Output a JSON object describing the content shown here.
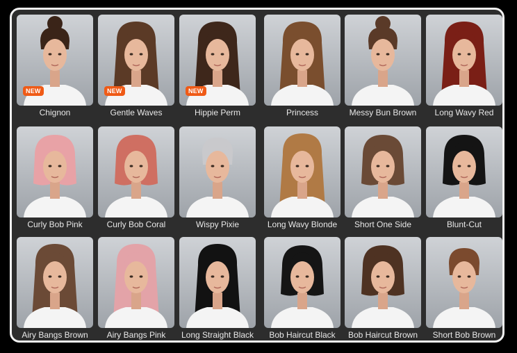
{
  "styles": [
    {
      "label": "Chignon",
      "badge": "NEW",
      "hair": "#3a2418",
      "shape": "bun"
    },
    {
      "label": "Gentle Waves",
      "badge": "NEW",
      "hair": "#5b3a26",
      "shape": "long"
    },
    {
      "label": "Hippie Perm",
      "badge": "NEW",
      "hair": "#3e271b",
      "shape": "long"
    },
    {
      "label": "Princess",
      "badge": "",
      "hair": "#7a4e2e",
      "shape": "long"
    },
    {
      "label": "Messy Bun Brown",
      "badge": "",
      "hair": "#5a3a28",
      "shape": "bun"
    },
    {
      "label": "Long Wavy Red",
      "badge": "",
      "hair": "#7a1f16",
      "shape": "long"
    },
    {
      "label": "Curly Bob Pink",
      "badge": "",
      "hair": "#e8a2a6",
      "shape": "bob"
    },
    {
      "label": "Curly Bob Coral",
      "badge": "",
      "hair": "#cf6f62",
      "shape": "bob"
    },
    {
      "label": "Wispy Pixie",
      "badge": "",
      "hair": "#c9c9cc",
      "shape": "pixie"
    },
    {
      "label": "Long Wavy Blonde",
      "badge": "",
      "hair": "#b07a45",
      "shape": "long"
    },
    {
      "label": "Short One Side",
      "badge": "",
      "hair": "#6a4a36",
      "shape": "bob"
    },
    {
      "label": "Blunt-Cut",
      "badge": "",
      "hair": "#141414",
      "shape": "bob"
    },
    {
      "label": "Airy Bangs Brown",
      "badge": "",
      "hair": "#6b4a36",
      "shape": "long"
    },
    {
      "label": "Airy Bangs Pink",
      "badge": "",
      "hair": "#e3a3a8",
      "shape": "long"
    },
    {
      "label": "Long Straight Black",
      "badge": "",
      "hair": "#121212",
      "shape": "long"
    },
    {
      "label": "Bob Haircut Black",
      "badge": "",
      "hair": "#151515",
      "shape": "bob"
    },
    {
      "label": "Bob Haircut Brown",
      "badge": "",
      "hair": "#4e3222",
      "shape": "bob"
    },
    {
      "label": "Short Bob Brown",
      "badge": "",
      "hair": "#7b4a2e",
      "shape": "pixie"
    }
  ]
}
